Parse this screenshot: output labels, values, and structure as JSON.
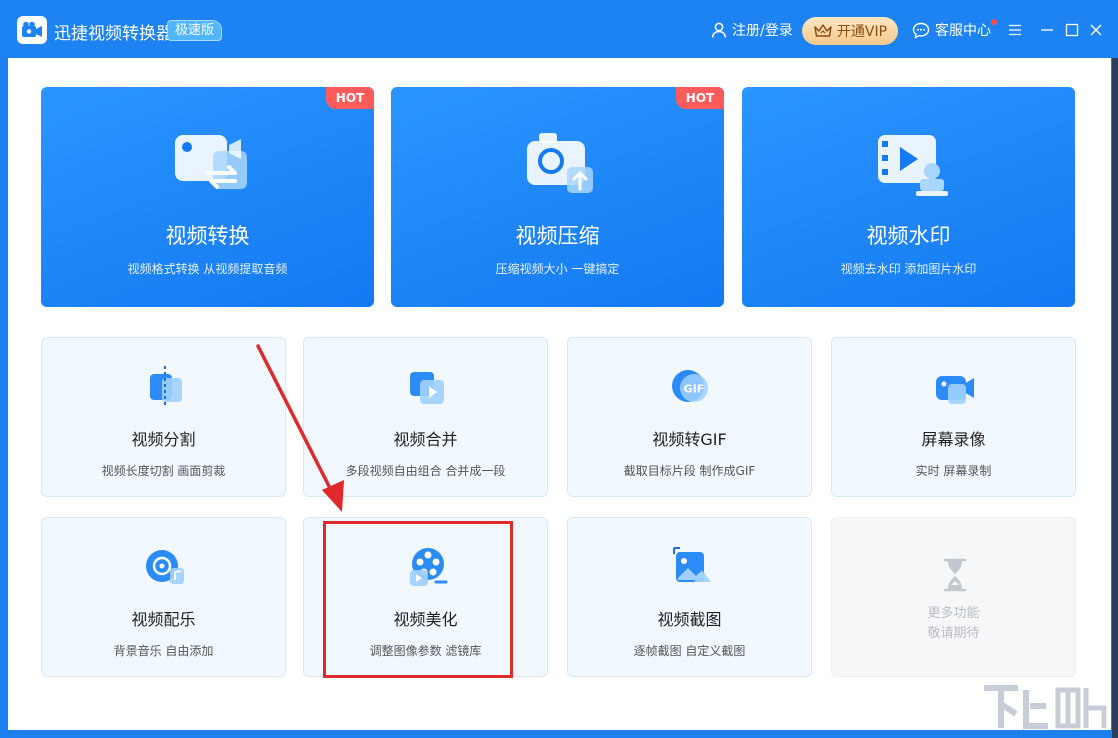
{
  "app": {
    "title": "迅捷视频转换器",
    "edition_badge": "极速版"
  },
  "header": {
    "login_label": "注册/登录",
    "vip_label": "开通VIP",
    "service_label": "客服中心"
  },
  "hero_cards": [
    {
      "title": "视频转换",
      "desc": "视频格式转换 从视频提取音频",
      "badge": "HOT"
    },
    {
      "title": "视频压缩",
      "desc": "压缩视频大小 一键搞定",
      "badge": "HOT"
    },
    {
      "title": "视频水印",
      "desc": "视频去水印 添加图片水印",
      "badge": ""
    }
  ],
  "tool_cards": [
    {
      "title": "视频分割",
      "desc": "视频长度切割 画面剪裁"
    },
    {
      "title": "视频合并",
      "desc": "多段视频自由组合 合并成一段"
    },
    {
      "title": "视频转GIF",
      "desc": "截取目标片段 制作成GIF"
    },
    {
      "title": "屏幕录像",
      "desc": "实时 屏幕录制"
    },
    {
      "title": "视频配乐",
      "desc": "背景音乐 自由添加"
    },
    {
      "title": "视频美化",
      "desc": "调整图像参数 滤镜库"
    },
    {
      "title": "视频截图",
      "desc": "逐帧截图 自定义截图"
    },
    {
      "title": "更多功能",
      "desc": "敬请期待"
    }
  ],
  "gif_icon_text": "GIF",
  "colors": {
    "titlebar": "#1d82f2",
    "hero": "#1479f2",
    "hot_badge": "#ff5b5b",
    "vip_text": "#8a4e12",
    "highlight": "#e0292a"
  }
}
